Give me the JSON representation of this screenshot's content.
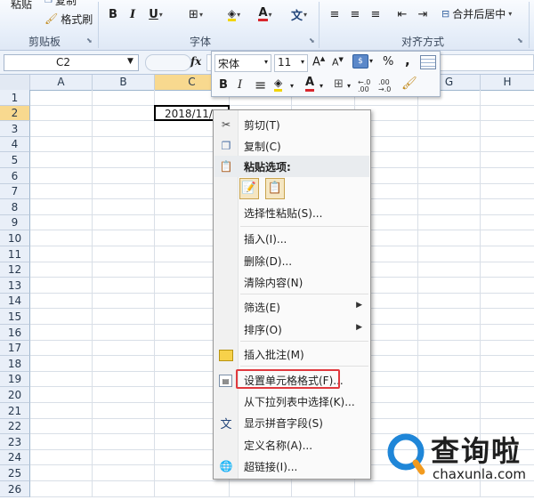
{
  "ribbon": {
    "paste_label": "粘贴",
    "copy_label": "复制",
    "format_painter_label": "格式刷",
    "clipboard_group": "剪贴板",
    "font_group": "字体",
    "align_group": "对齐方式",
    "bold": "B",
    "italic": "I",
    "underline": "U",
    "merge_center_label": "合并后居中",
    "wen_glyph": "文"
  },
  "formula_bar": {
    "name_box": "C2",
    "fx": "fx"
  },
  "mini_toolbar": {
    "font_name": "宋体",
    "font_size": "11",
    "grow": "A",
    "shrink": "A",
    "percent": "%",
    "comma": ",",
    "bold": "B",
    "italic": "I",
    "dec_inc": "+.0 .00",
    "dec_dec": ".00 +.0"
  },
  "sheet": {
    "columns": [
      "A",
      "B",
      "C",
      "",
      "",
      "",
      "G",
      "H"
    ],
    "rows": [
      "1",
      "2",
      "3",
      "4",
      "5",
      "6",
      "7",
      "8",
      "9",
      "10",
      "11",
      "12",
      "13",
      "14",
      "15",
      "16",
      "17",
      "18",
      "19",
      "20",
      "21",
      "22",
      "23",
      "24",
      "25",
      "26"
    ],
    "c2_value": "2018/11/",
    "selected_cell": "C2"
  },
  "context_menu": {
    "cut": "剪切(T)",
    "copy": "复制(C)",
    "paste_options": "粘贴选项:",
    "paste_special": "选择性粘贴(S)...",
    "insert": "插入(I)...",
    "delete": "删除(D)...",
    "clear": "清除内容(N)",
    "filter": "筛选(E)",
    "sort": "排序(O)",
    "insert_comment": "插入批注(M)",
    "format_cells": "设置单元格格式(F)...",
    "pick_list": "从下拉列表中选择(K)...",
    "phonetic": "显示拼音字段(S)",
    "define_name": "定义名称(A)...",
    "hyperlink": "超链接(I)..."
  },
  "watermark": {
    "cn": "查询啦",
    "url": "chaxunla.com"
  },
  "colors": {
    "accent_highlight": "#e0393e",
    "watermark_blue": "#1f86d8",
    "watermark_orange": "#f29b1f"
  }
}
